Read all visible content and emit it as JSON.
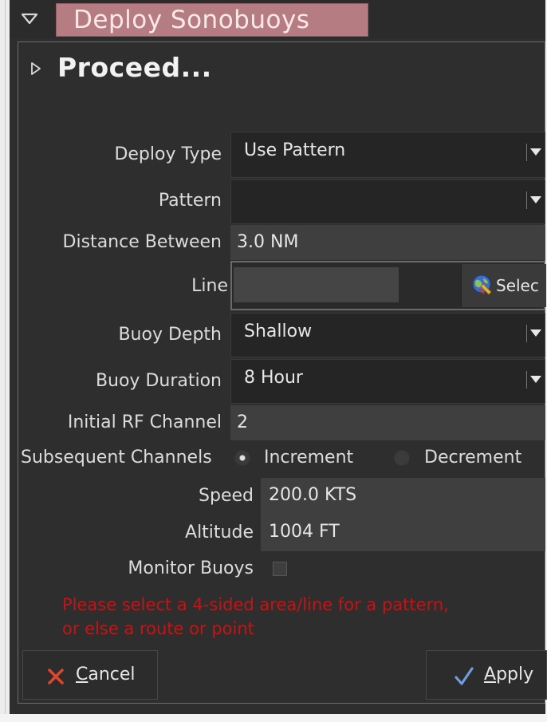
{
  "window": {
    "title": "Deploy Sonobuoys"
  },
  "section": {
    "title": "Proceed..."
  },
  "form": {
    "deploy_type": {
      "label": "Deploy Type",
      "value": "Use Pattern"
    },
    "pattern": {
      "label": "Pattern",
      "value": ""
    },
    "distance_between": {
      "label": "Distance Between",
      "value": "3.0 NM"
    },
    "line": {
      "label": "Line",
      "value": "",
      "select_label": "Selec"
    },
    "buoy_depth": {
      "label": "Buoy Depth",
      "value": "Shallow"
    },
    "buoy_duration": {
      "label": "Buoy Duration",
      "value": "8 Hour"
    },
    "initial_rf_channel": {
      "label": "Initial RF Channel",
      "value": "2"
    },
    "subsequent_channels": {
      "label": "Subsequent Channels",
      "options": [
        "Increment",
        "Decrement"
      ],
      "selected": "Increment"
    },
    "speed": {
      "label": "Speed",
      "value": "200.0 KTS"
    },
    "altitude": {
      "label": "Altitude",
      "value": "1004 FT"
    },
    "monitor_buoys": {
      "label": "Monitor Buoys",
      "checked": false
    }
  },
  "warning": {
    "line1": "Please select a 4-sided area/line for a pattern,",
    "line2": "or else a route or point"
  },
  "buttons": {
    "cancel_mnemonic": "C",
    "cancel_rest": "ancel",
    "apply_mnemonic": "A",
    "apply_rest": "pply"
  },
  "colors": {
    "title_tab": "#b57d82",
    "panel_bg": "#2e2e2e",
    "warning_text": "#c21515",
    "cancel_icon": "#e0452e",
    "apply_icon": "#6f9ddd"
  },
  "icons": {
    "window_collapse": "triangle-down-icon",
    "section_expand": "triangle-right-icon",
    "select": "globe-select-icon",
    "cancel": "x-cross-icon",
    "apply": "checkmark-icon"
  }
}
